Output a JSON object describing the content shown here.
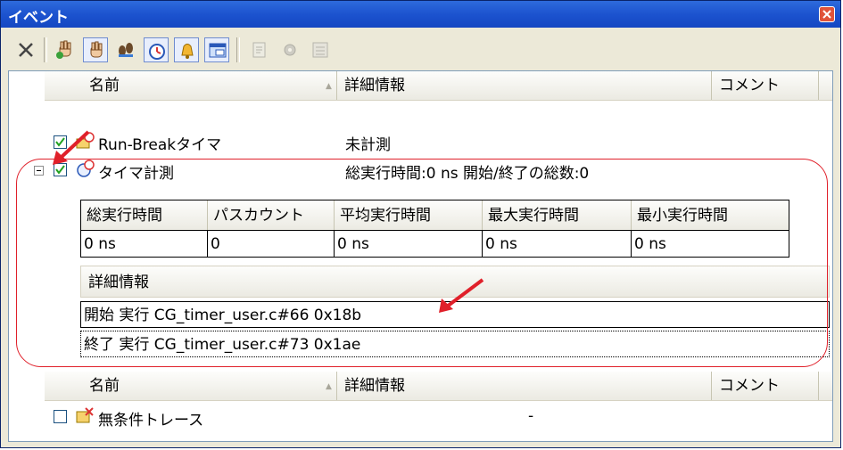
{
  "window": {
    "title": "イベント"
  },
  "icons": {
    "delete": "delete-icon",
    "hardware_break": "hand-icon",
    "software_break": "hand-icon",
    "trace": "footprints-icon",
    "timer": "timer-icon",
    "conditional_trace": "bell-icon",
    "point_trace": "window-icon",
    "disabled_1": "edit-icon",
    "disabled_2": "gear-icon",
    "disabled_3": "list-icon"
  },
  "columns": {
    "name": "名前",
    "detail": "詳細情報",
    "comment": "コメント"
  },
  "events": {
    "run_break": {
      "name": "Run-Breakタイマ",
      "detail": "未計測",
      "checked": true
    },
    "timer": {
      "name": "タイマ計測",
      "detail": "総実行時間:0 ns 開始/終了の総数:0",
      "checked": true
    }
  },
  "timer_table": {
    "headers": [
      "総実行時間",
      "パスカウント",
      "平均実行時間",
      "最大実行時間",
      "最小実行時間"
    ],
    "values": [
      "0 ns",
      "0",
      "0 ns",
      "0 ns",
      "0 ns"
    ]
  },
  "timer_detail": {
    "header": "詳細情報",
    "start": "開始 実行 CG_timer_user.c#66 0x18b",
    "end": "終了 実行 CG_timer_user.c#73 0x1ae"
  },
  "second_group": {
    "columns": {
      "name": "名前",
      "detail": "詳細情報",
      "comment": "コメント"
    },
    "item": {
      "name": "無条件トレース",
      "detail": "-",
      "checked": false
    }
  },
  "colors": {
    "title_bar": "#1c53cf",
    "annotation": "#e0202a",
    "grid_border": "#000000"
  }
}
